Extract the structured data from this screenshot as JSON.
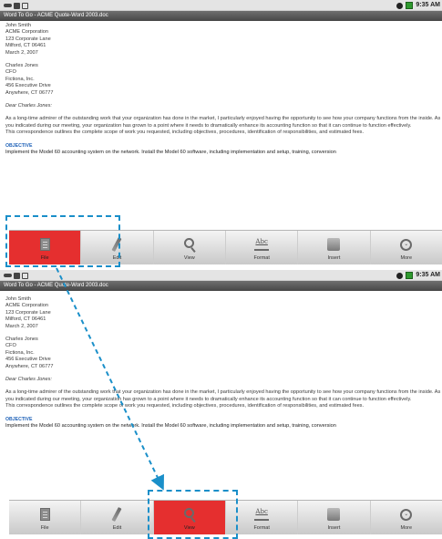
{
  "status_bar": {
    "time": "9:35 AM"
  },
  "document": {
    "title": "Word To Go - ACME Quote-Word 2003.doc",
    "sender": [
      "John Smith",
      "ACME Corporation",
      "123 Corporate Lane",
      "Milford, CT 06461",
      "March 2, 2007"
    ],
    "recipient": [
      "Charles Jones",
      "CFO",
      "Fictiona, Inc.",
      "456 Executive Drive",
      "Anywhere, CT 06777"
    ],
    "salutation": "Dear Charles Jones:",
    "body": "As a long-time admirer of the outstanding work that your organization has done in the market, I particularly enjoyed having the opportunity to see how your company functions from the inside. As you indicated during our meeting, your organization has grown to a point where it needs to dramatically enhance its accounting function so that it can continue to function effectively.",
    "body2": "This correspondence outlines the complete scope of work you requested, including objectives, procedures, identification of responsibilities, and estimated fees.",
    "heading": "OBJECTIVE",
    "trailing": "Implement the Model 60 accounting system on the network. Install the Model 60 software, including implementation and setup, training, conversion"
  },
  "toolbar": {
    "items": [
      {
        "label": "File",
        "icon": "file-icon"
      },
      {
        "label": "Edit",
        "icon": "edit-icon"
      },
      {
        "label": "View",
        "icon": "view-icon"
      },
      {
        "label": "Format",
        "icon": "format-icon"
      },
      {
        "label": "Insert",
        "icon": "insert-icon"
      },
      {
        "label": "More",
        "icon": "more-icon"
      }
    ]
  },
  "screens": [
    {
      "active_item": "File"
    },
    {
      "active_item": "View"
    }
  ],
  "colors": {
    "active_button": "#e52f2f",
    "callout": "#1a8fc9",
    "heading": "#1f62b8",
    "title_bar": "#5a5a5a"
  }
}
